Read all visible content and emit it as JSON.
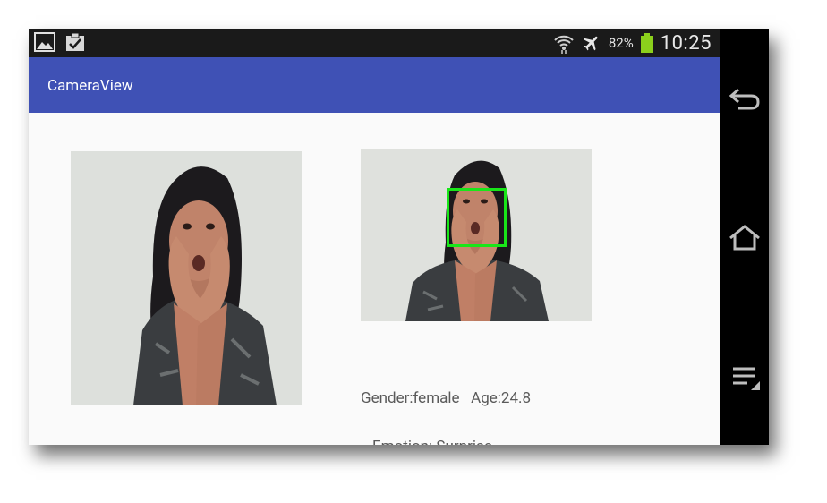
{
  "status_bar": {
    "left_icons": [
      "gallery-icon",
      "clipboard-check-icon"
    ],
    "right_icons": [
      "wifi-icon",
      "airplane-icon",
      "battery-icon"
    ],
    "battery_percent": "82%",
    "battery_level": 0.82,
    "time": "10:25"
  },
  "app_bar": {
    "title": "CameraView",
    "color": "#3f51b5"
  },
  "main": {
    "gender_text": "Gender:female   Age:24.8",
    "emotion_text": "Emotion: Surprise",
    "face_box_color": "#19e619"
  },
  "nav": {
    "buttons": [
      "back-icon",
      "home-icon",
      "menu-icon"
    ]
  }
}
